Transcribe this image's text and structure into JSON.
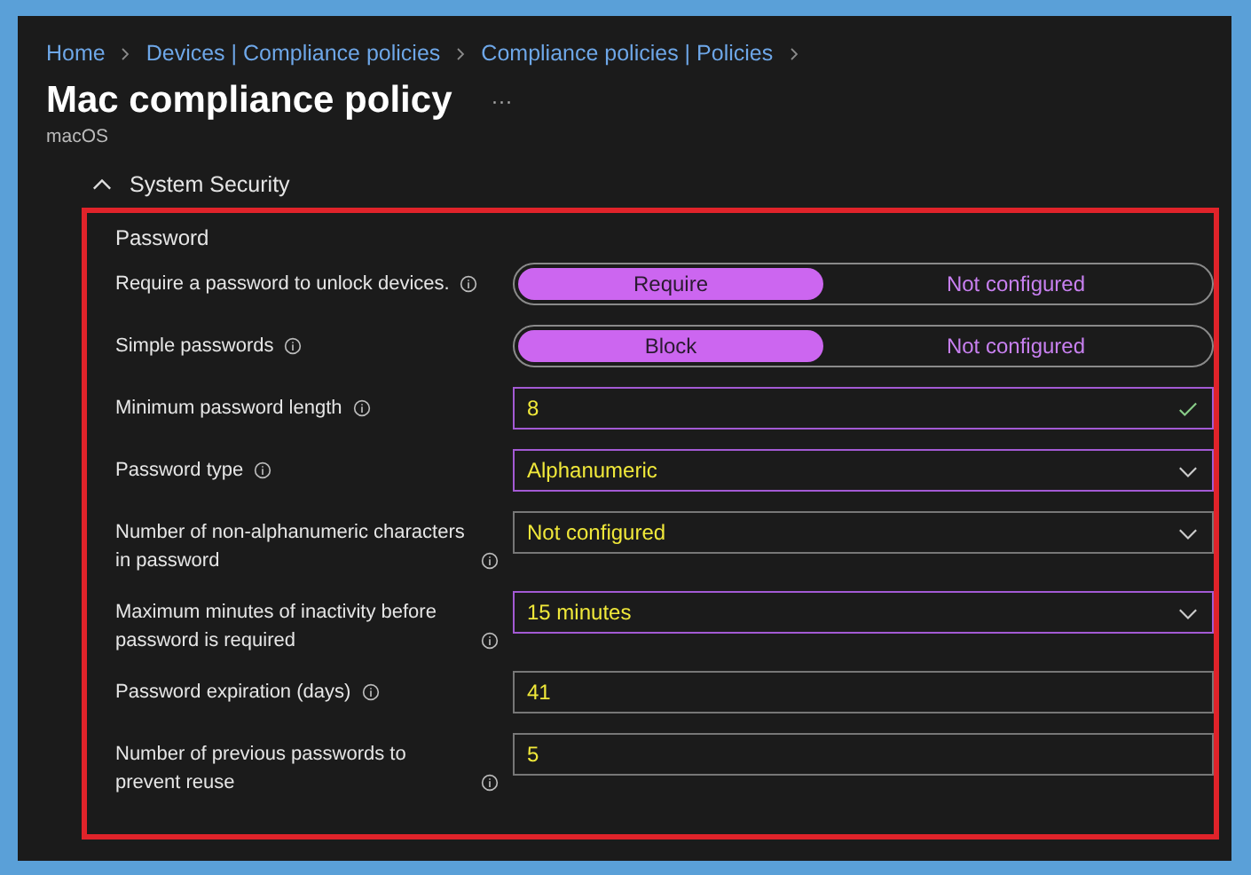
{
  "breadcrumb": [
    "Home",
    "Devices | Compliance policies",
    "Compliance policies | Policies"
  ],
  "page": {
    "title": "Mac compliance policy",
    "more": "···",
    "subtitle": "macOS"
  },
  "section": {
    "title": "System Security",
    "expanded": true
  },
  "group": {
    "title": "Password",
    "highlighted": true
  },
  "settings": [
    {
      "kind": "toggle",
      "label": "Require a password to unlock devices.",
      "options": [
        {
          "label": "Require",
          "selected": true
        },
        {
          "label": "Not configured",
          "selected": false
        }
      ]
    },
    {
      "kind": "toggle",
      "label": "Simple passwords",
      "options": [
        {
          "label": "Block",
          "selected": true
        },
        {
          "label": "Not configured",
          "selected": false
        }
      ]
    },
    {
      "kind": "text",
      "label": "Minimum password length",
      "value": "8",
      "edited": true,
      "valid": true
    },
    {
      "kind": "dropdown",
      "label": "Password type",
      "value": "Alphanumeric",
      "edited": true
    },
    {
      "kind": "dropdown",
      "label": "Number of non-alphanumeric characters in password",
      "value": "Not configured",
      "edited": false
    },
    {
      "kind": "dropdown",
      "label": "Maximum minutes of inactivity before password is required",
      "value": "15 minutes",
      "edited": true
    },
    {
      "kind": "text",
      "label": "Password expiration (days)",
      "value": "41",
      "edited": false,
      "valid": false
    },
    {
      "kind": "text",
      "label": "Number of previous passwords to prevent reuse",
      "value": "5",
      "edited": false,
      "valid": false
    }
  ]
}
